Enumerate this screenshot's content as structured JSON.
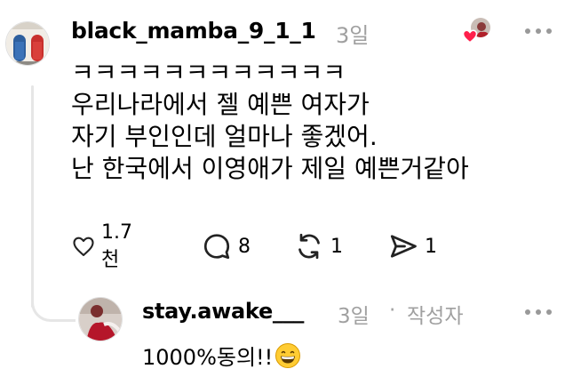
{
  "main_comment": {
    "username": "black_mamba_9_1_1",
    "timestamp": "3일",
    "lines": [
      "ㅋㅋㅋㅋㅋㅋㅋㅋㅋㅋㅋㅋ",
      "우리나라에서 젤 예쁜 여자가",
      "자기 부인인데 얼마나 좋겠어.",
      "난 한국에서 이영애가 제일 예쁜거같아"
    ],
    "actions": {
      "like_count": "1.7천",
      "comment_count": "8",
      "repost_count": "1",
      "share_count": "1"
    }
  },
  "reply": {
    "username": "stay.awake___",
    "timestamp": "3일",
    "separator": "·",
    "author_tag": "작성자",
    "text": "1000%동의!!"
  },
  "icons": {
    "like": "heart-outline-icon",
    "comment": "speech-bubble-icon",
    "repost": "repost-arrows-icon",
    "share": "send-plane-icon",
    "more": "more-dots-icon",
    "liked_badge": "red-heart-icon",
    "emoji": "grinning-face-emoji"
  },
  "colors": {
    "muted": "#a0a0a0",
    "thread_line": "#e6e6e6",
    "heart_red": "#ff1f4b"
  }
}
